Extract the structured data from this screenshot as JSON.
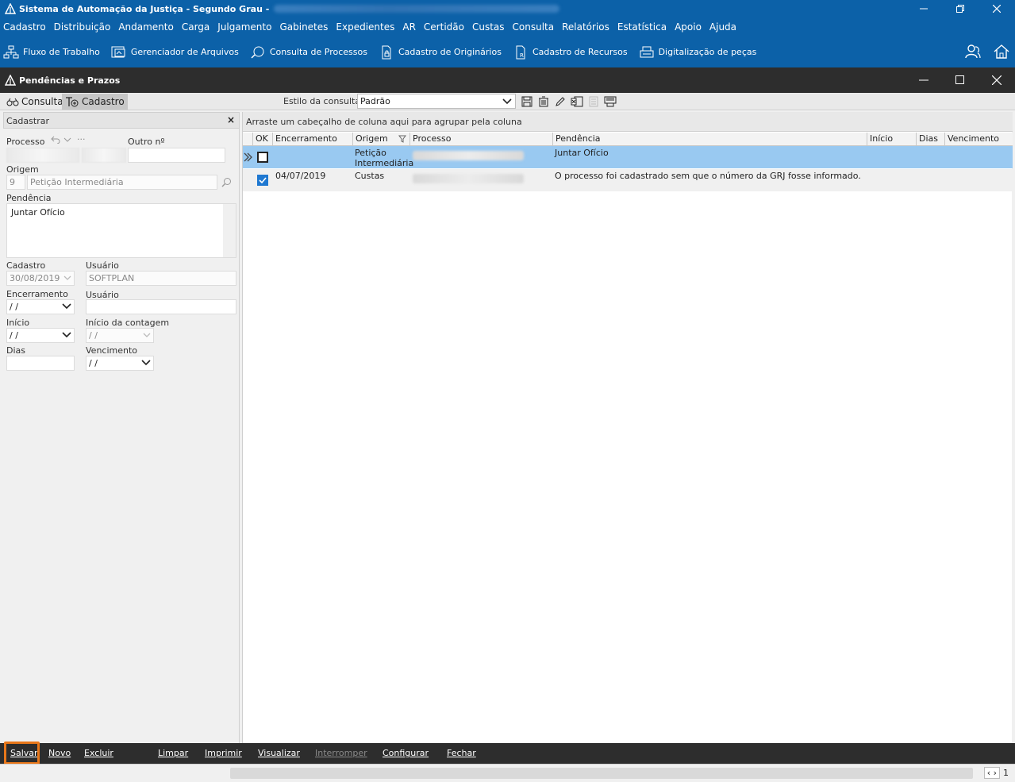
{
  "window": {
    "title": "Sistema de Automação da Justiça - Segundo Grau -"
  },
  "menu": [
    "Cadastro",
    "Distribuição",
    "Andamento",
    "Carga",
    "Julgamento",
    "Gabinetes",
    "Expedientes",
    "AR",
    "Certidão",
    "Custas",
    "Consulta",
    "Relatórios",
    "Estatística",
    "Apoio",
    "Ajuda"
  ],
  "toolbar": [
    {
      "label": "Fluxo de Trabalho",
      "icon": "workflow-icon"
    },
    {
      "label": "Gerenciador de Arquivos",
      "icon": "file-manager-icon"
    },
    {
      "label": "Consulta de Processos",
      "icon": "search-process-icon"
    },
    {
      "label": "Cadastro de Originários",
      "icon": "lock-document-icon"
    },
    {
      "label": "Cadastro de Recursos",
      "icon": "resource-document-icon"
    },
    {
      "label": "Digitalização de peças",
      "icon": "scanner-icon"
    }
  ],
  "inner_window": {
    "title": "Pendências e Prazos"
  },
  "tabs": {
    "consulta": "Consulta",
    "cadastro": "Cadastro"
  },
  "estilo": {
    "label": "Estilo da consulta",
    "value": "Padrão"
  },
  "form": {
    "header": "Cadastrar",
    "close": "×",
    "processo_label": "Processo",
    "processo_ellipsis": "···",
    "outro_label": "Outro nº",
    "origem_label": "Origem",
    "origem_code": "9",
    "origem_value": "Petição Intermediária",
    "pendencia_label": "Pendência",
    "pendencia_value": "Juntar Ofício",
    "cadastro_label": "Cadastro",
    "cadastro_value": "30/08/2019",
    "usuario_label": "Usuário",
    "usuario_value": "SOFTPLAN",
    "encerramento_label": "Encerramento",
    "encerramento_value": " / /",
    "usuario2_label": "Usuário",
    "inicio_label": "Início",
    "inicio_value": " / /",
    "inicio_contagem_label": "Início da contagem",
    "inicio_contagem_value": " / /",
    "dias_label": "Dias",
    "vencimento_label": "Vencimento",
    "vencimento_value": " / /"
  },
  "grid": {
    "group_hint": "Arraste um cabeçalho de coluna aqui para agrupar pela coluna",
    "columns": [
      "OK",
      "Encerramento",
      "Origem",
      "Processo",
      "Pendência",
      "Início",
      "Dias",
      "Vencimento"
    ],
    "rows": [
      {
        "ok": false,
        "encerramento": "",
        "origem_l1": "Petição",
        "origem_l2": "Intermediária",
        "pendencia": "Juntar Ofício"
      },
      {
        "ok": true,
        "encerramento": "04/07/2019",
        "origem_l1": "Custas",
        "origem_l2": "",
        "pendencia": "O processo foi cadastrado sem que o número da GRJ fosse informado."
      }
    ]
  },
  "bottom": {
    "salvar": "Salvar",
    "novo": "Novo",
    "excluir": "Excluir",
    "limpar": "Limpar",
    "imprimir": "Imprimir",
    "visualizar": "Visualizar",
    "interromper": "Interromper",
    "configurar": "Configurar",
    "fechar": "Fechar"
  },
  "pager": {
    "page": "1"
  },
  "colors": {
    "header_blue": "#0c61a8",
    "dark_bar": "#2d2d2d",
    "selected_row": "#99c9f1",
    "highlight": "#e8771a"
  }
}
